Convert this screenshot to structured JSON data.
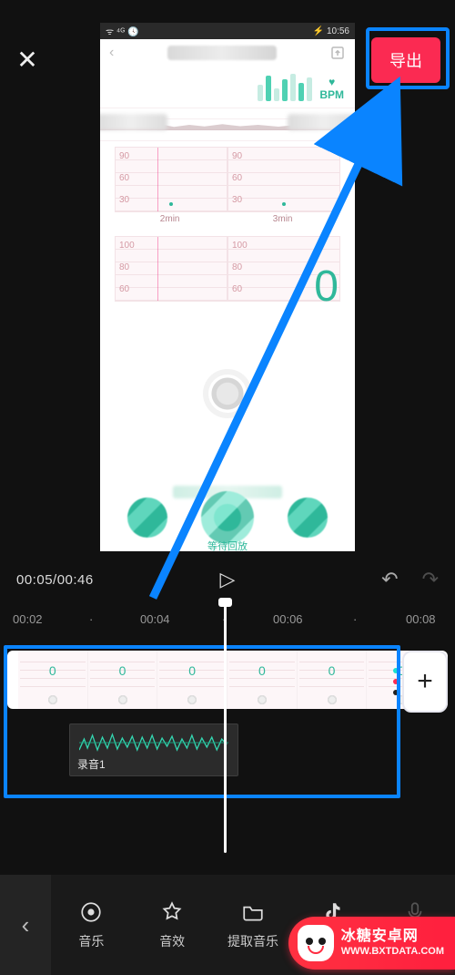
{
  "topbar": {
    "export_label": "导出"
  },
  "preview": {
    "status_left": "ᯤ ⁴ᴳ 🕓",
    "status_right": "⚡ 10:56",
    "big_value": "0",
    "bpm_label": "BPM",
    "minichart_a": {
      "t1": "90",
      "t2": "60",
      "t3": "30",
      "label": "2min"
    },
    "minichart_b": {
      "t1": "90",
      "t2": "60",
      "t3": "30",
      "label": "3min"
    },
    "minichart_c": {
      "t1": "100",
      "t2": "80",
      "t3": "60"
    },
    "minichart_d": {
      "t1": "100",
      "t2": "80",
      "t3": "60"
    },
    "caption": "等待回放"
  },
  "playback": {
    "time": "00:05/00:46"
  },
  "ruler": {
    "marks": [
      "00:02",
      "·",
      "00:04",
      "·",
      "00:06",
      "·",
      "00:08"
    ]
  },
  "audio": {
    "clip_label": "录音1"
  },
  "thumb_zero": "0",
  "add_label": "+",
  "toolbar": {
    "music": "音乐",
    "sfx": "音效",
    "extract": "提取音乐",
    "douyin": "抖音收藏",
    "record": "录音"
  },
  "watermark": {
    "cn": "冰糖安卓网",
    "en": "WWW.BXTDATA.COM"
  }
}
